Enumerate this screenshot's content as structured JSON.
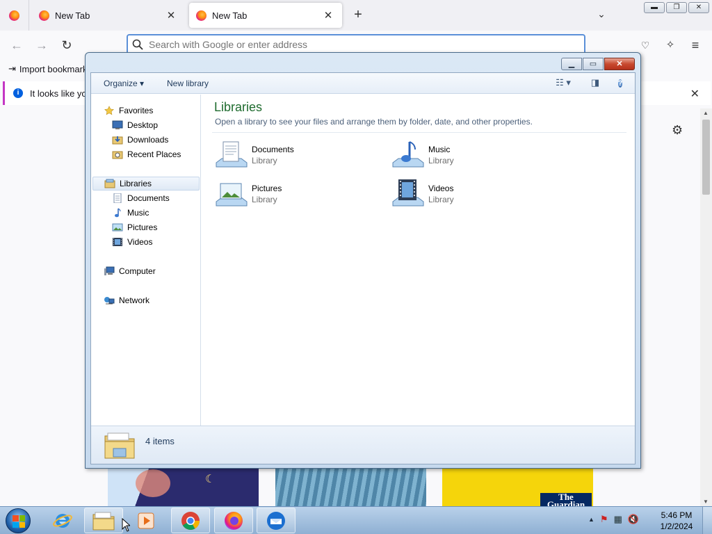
{
  "browser": {
    "tabs": [
      {
        "label": "New Tab",
        "active": false
      },
      {
        "label": "New Tab",
        "active": true
      }
    ],
    "url_placeholder": "Search with Google or enter address",
    "bookmarks_bar": {
      "import_label": "Import bookmark"
    },
    "notice": {
      "text": "It looks like you"
    }
  },
  "explorer": {
    "toolbar": {
      "organize_label": "Organize",
      "new_library_label": "New library"
    },
    "nav": {
      "favorites": {
        "label": "Favorites",
        "items": [
          "Desktop",
          "Downloads",
          "Recent Places"
        ]
      },
      "libraries": {
        "label": "Libraries",
        "items": [
          "Documents",
          "Music",
          "Pictures",
          "Videos"
        ]
      },
      "computer": "Computer",
      "network": "Network"
    },
    "content": {
      "title": "Libraries",
      "subtitle": "Open a library to see your files and arrange them by folder, date, and other properties.",
      "items": [
        {
          "name": "Documents",
          "type": "Library"
        },
        {
          "name": "Music",
          "type": "Library"
        },
        {
          "name": "Pictures",
          "type": "Library"
        },
        {
          "name": "Videos",
          "type": "Library"
        }
      ]
    },
    "status": {
      "count": "4 items"
    }
  },
  "taskbar": {
    "clock_time": "5:46 PM",
    "clock_date": "1/2/2024"
  }
}
